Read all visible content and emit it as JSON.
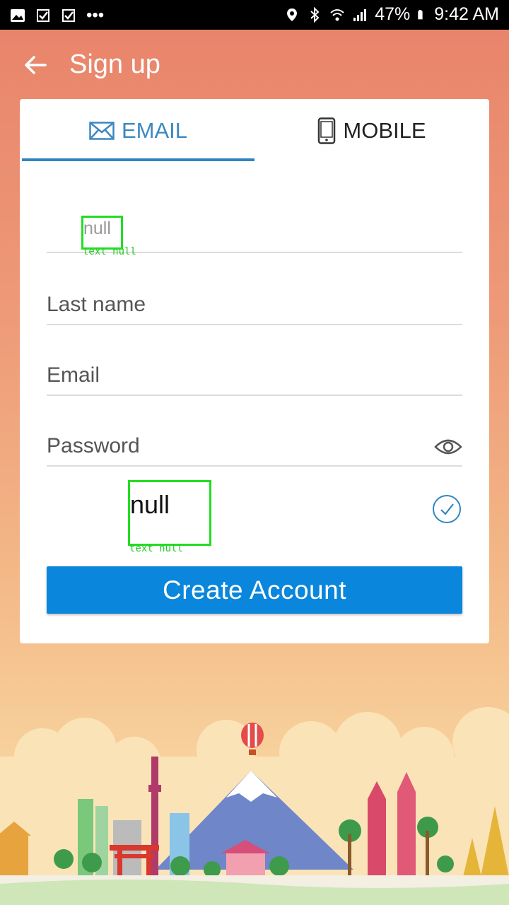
{
  "status_bar": {
    "battery": "47%",
    "time": "9:42 AM",
    "dots": "•••"
  },
  "header": {
    "title": "Sign up"
  },
  "tabs": [
    {
      "label": "EMAIL",
      "icon": "mail-icon",
      "active": true
    },
    {
      "label": "MOBILE",
      "icon": "phone-icon",
      "active": false
    }
  ],
  "form": {
    "first_name_value": "null",
    "first_name_tag": "text null",
    "last_name_label": "Last name",
    "email_label": "Email",
    "password_label": "Password",
    "terms_value": "null",
    "terms_tag": "text null",
    "submit_label": "Create Account"
  },
  "colors": {
    "accent": "#2f86c1",
    "button": "#0a86dc",
    "header_bg": "#e8826a"
  }
}
